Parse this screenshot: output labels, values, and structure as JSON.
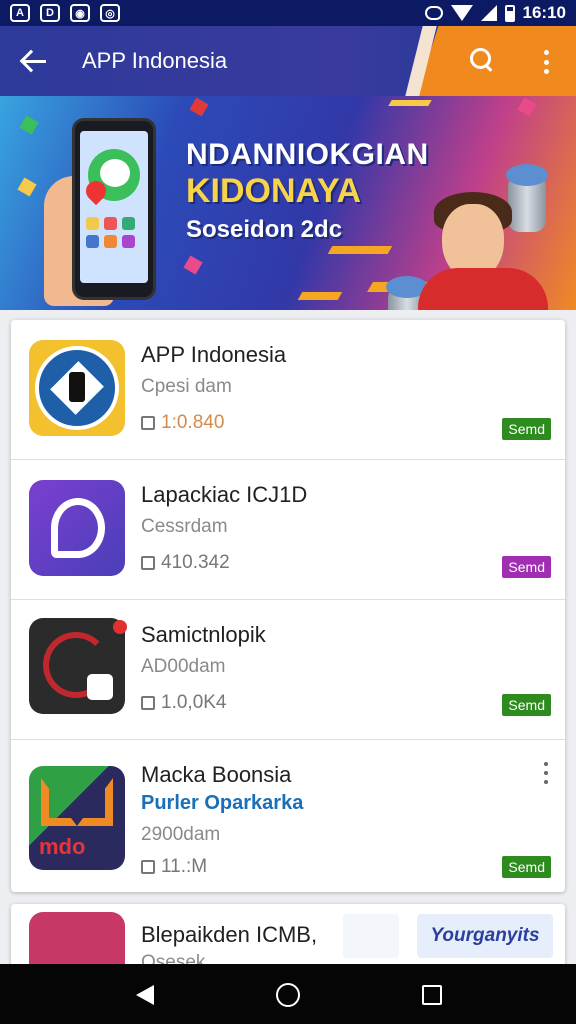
{
  "status_bar": {
    "time": "16:10"
  },
  "app_bar": {
    "title": "APP Indonesia"
  },
  "banner": {
    "line1": "NDANNIOKGIAN",
    "line2": "KIDONAYA",
    "line3": "Soseidon 2dc"
  },
  "apps": [
    {
      "name": "APP Indonesia",
      "subtitle": "Cpesi dam",
      "meta": "1:0.840",
      "badge": "Semd",
      "badge_color": "#2e8b1e"
    },
    {
      "name": "Lapackiac ICJ1D",
      "subtitle": "Cessrdam",
      "meta": "410.342",
      "badge": "Semd",
      "badge_color": "#a12eb2"
    },
    {
      "name": "Samictnlopik",
      "subtitle": "AD00dam",
      "meta": "1.0,0K4",
      "badge": "Semd",
      "badge_color": "#2e8b1e"
    },
    {
      "name": "Macka Boonsia",
      "developer": "Purler Oparkarka",
      "subtitle": "2900dam",
      "meta": "11.:M",
      "badge": "Semd",
      "badge_color": "#2e8b1e"
    }
  ],
  "peek_item": {
    "name": "Blepaikden ICMB,",
    "subtitle": "Osesek",
    "tile_text": "Yourganyits"
  }
}
